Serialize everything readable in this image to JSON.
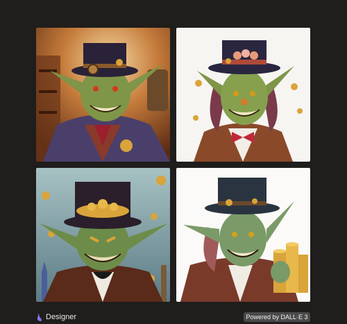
{
  "tiles": [
    {
      "name": "goblin-portrait-library"
    },
    {
      "name": "goblin-portrait-bowtie"
    },
    {
      "name": "goblin-portrait-coins-hat"
    },
    {
      "name": "goblin-portrait-coin-stack"
    }
  ],
  "footer": {
    "brand_label": "Designer",
    "brand_icon": "designer-logo-icon",
    "powered_label": "Powered by DALL·E 3"
  },
  "colors": {
    "background": "#1f1e1c",
    "badge": "#4a4a4a",
    "goblin_skin": "#7f9548",
    "gold": "#d9a43a"
  }
}
